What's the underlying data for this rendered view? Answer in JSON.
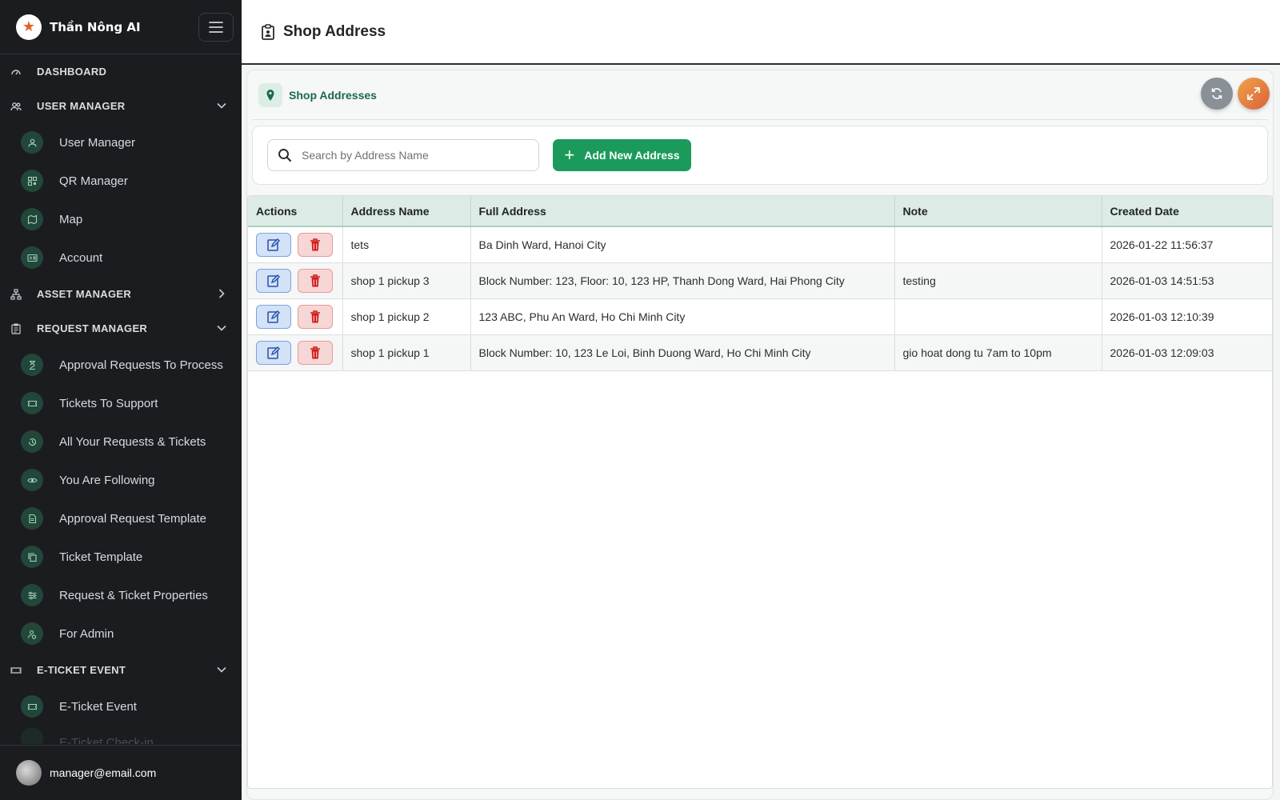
{
  "app": {
    "name": "Thần Nông AI"
  },
  "header": {
    "title": "Shop Address"
  },
  "sidebar": {
    "sections": [
      {
        "label": "DASHBOARD"
      },
      {
        "label": "USER MANAGER",
        "items": [
          "User Manager",
          "QR Manager",
          "Map",
          "Account"
        ]
      },
      {
        "label": "ASSET MANAGER"
      },
      {
        "label": "REQUEST MANAGER",
        "items": [
          "Approval Requests To Process",
          "Tickets To Support",
          "All Your Requests & Tickets",
          "You Are Following",
          "Approval Request Template",
          "Ticket Template",
          "Request & Ticket Properties",
          "For Admin"
        ]
      },
      {
        "label": "E-TICKET EVENT",
        "items": [
          "E-Ticket Event",
          "E-Ticket Check-in"
        ]
      }
    ],
    "user_email": "manager@email.com"
  },
  "panel": {
    "title": "Shop Addresses",
    "search_placeholder": "Search by Address Name",
    "add_label": "Add New Address"
  },
  "table": {
    "columns": [
      "Actions",
      "Address Name",
      "Full Address",
      "Note",
      "Created Date"
    ],
    "rows": [
      {
        "name": "tets",
        "address": "Ba Dinh Ward, Hanoi City",
        "note": "",
        "created": "2026-01-22 11:56:37"
      },
      {
        "name": "shop 1 pickup 3",
        "address": "Block Number: 123, Floor: 10, 123 HP, Thanh Dong Ward, Hai Phong City",
        "note": "testing",
        "created": "2026-01-03 14:51:53"
      },
      {
        "name": "shop 1 pickup 2",
        "address": "123 ABC, Phu An Ward, Ho Chi Minh City",
        "note": "",
        "created": "2026-01-03 12:10:39"
      },
      {
        "name": "shop 1 pickup 1",
        "address": "Block Number: 10, 123 Le Loi, Binh Duong Ward, Ho Chi Minh City",
        "note": "gio hoat dong tu 7am to 10pm",
        "created": "2026-01-03 12:09:03"
      }
    ]
  },
  "colors": {
    "accent": "#1b9a5c",
    "sidebar_bg": "#1b1c20",
    "header_row": "#dcebe5"
  },
  "icons": {
    "brand": "star-logo-icon",
    "search": "search-icon",
    "edit": "edit-icon",
    "delete": "trash-icon",
    "refresh": "refresh-icon",
    "expand": "expand-icon",
    "pin": "map-pin-icon"
  }
}
